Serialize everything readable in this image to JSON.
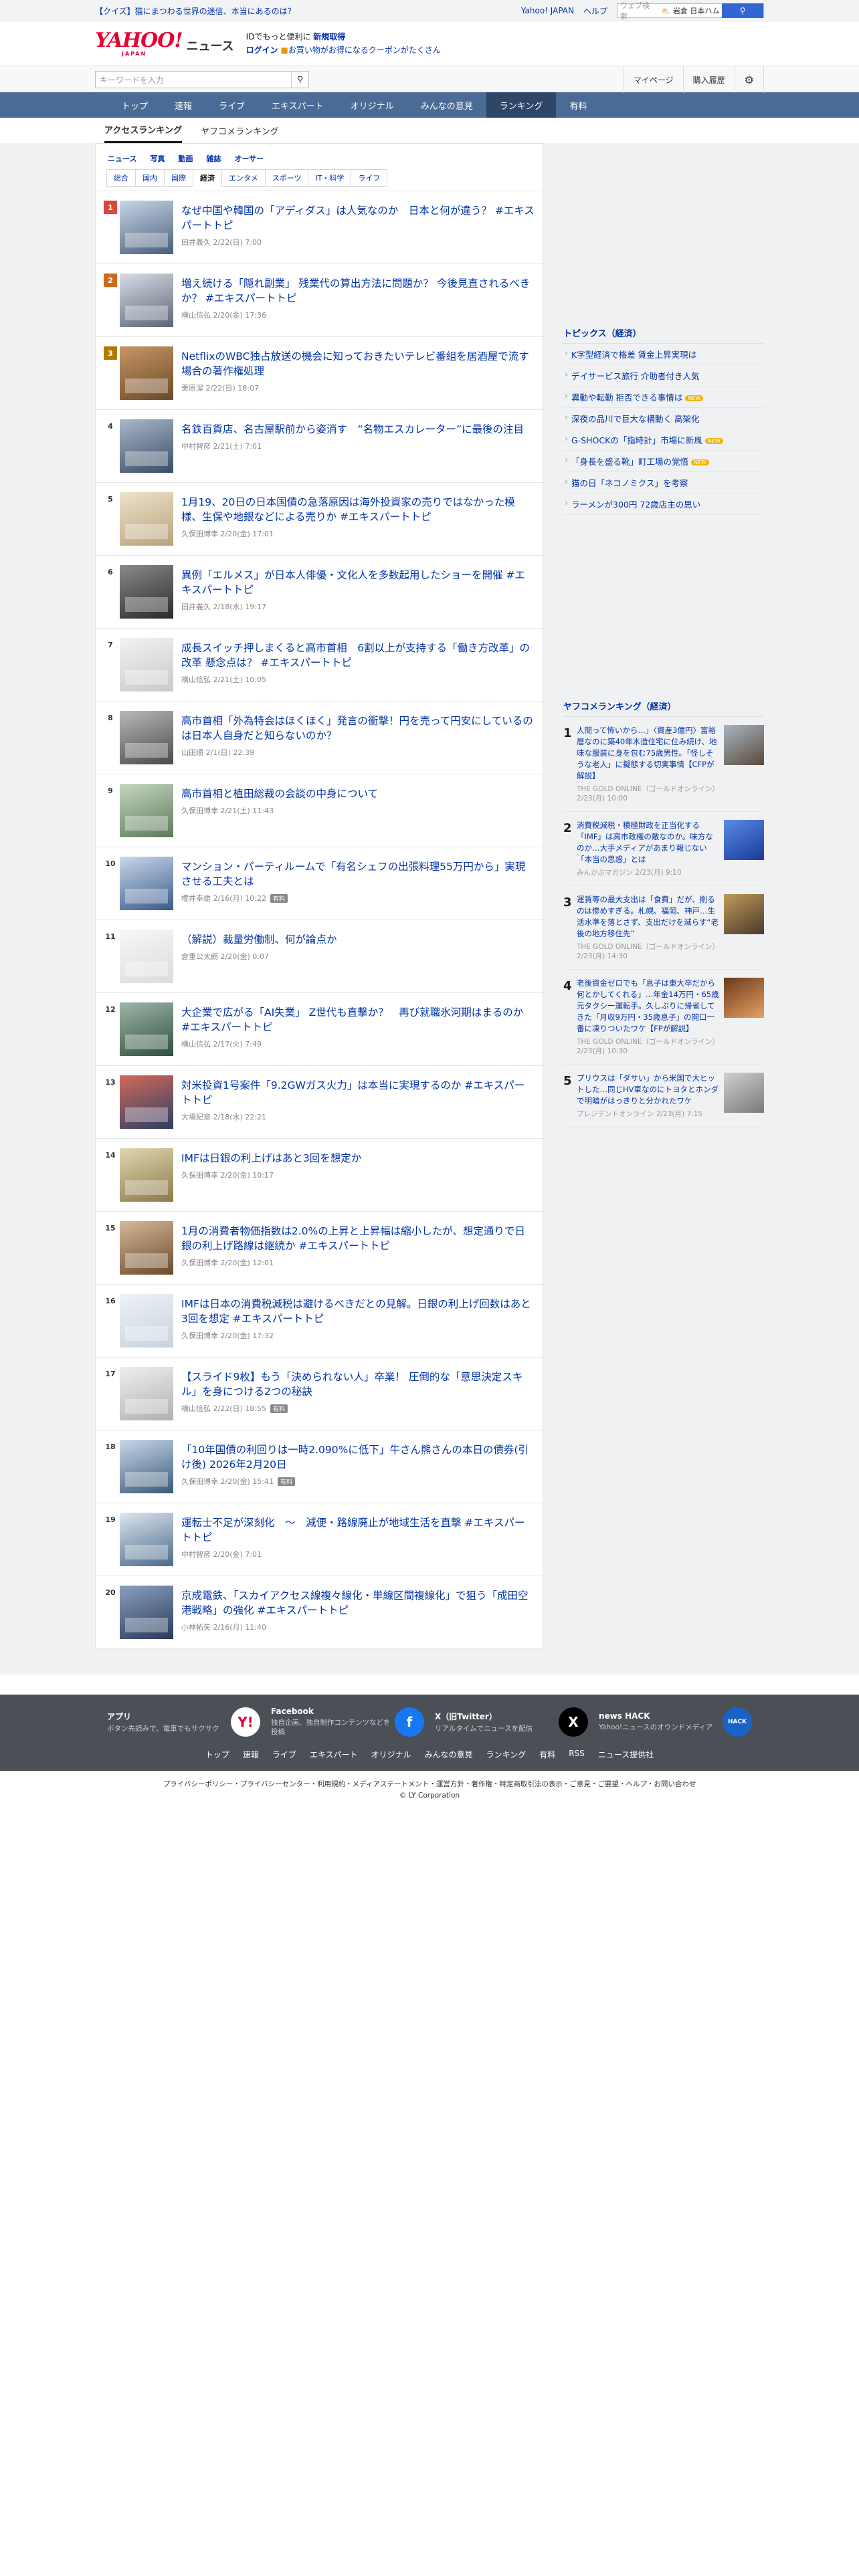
{
  "topbar": {
    "quiz": "【クイズ】猫にまつわる世界の迷信、本当にあるのは？",
    "links": [
      "Yahoo! JAPAN",
      "ヘルプ"
    ],
    "search_placeholder": "ウェブ検索",
    "loc": "⛅ 岩倉 日本ハム",
    "search_icon": "search-icon"
  },
  "header": {
    "logo_yahoo": "YAHOO!",
    "logo_japan": "JAPAN",
    "logo_news": "ニュース",
    "promo1": "IDでもっと便利に",
    "promo1b": "新規取得",
    "promo2a": "ログイン",
    "promo2b": "お買い物がお得になるクーポンがたくさん"
  },
  "search": {
    "placeholder": "キーワードを入力"
  },
  "account": {
    "mypage": "マイページ",
    "history": "購入履歴",
    "gear": "gear-icon"
  },
  "gnav": [
    "トップ",
    "速報",
    "ライブ",
    "エキスパート",
    "オリジナル",
    "みんなの意見",
    "ランキング",
    "有料"
  ],
  "subnav": [
    "アクセスランキング",
    "ヤフコメランキング"
  ],
  "cat1": [
    "ニュース",
    "写真",
    "動画",
    "雑誌",
    "オーサー"
  ],
  "cat2": [
    "総合",
    "国内",
    "国際",
    "経済",
    "エンタメ",
    "スポーツ",
    "IT・科学",
    "ライフ"
  ],
  "ranks": [
    {
      "n": "1",
      "title": "なぜ中国や韓国の「アディダス」は人気なのか　日本と何が違う？ #エキスパートトピ",
      "meta": "田井義久 2/22(日) 7:00",
      "tag": "",
      "c1": "#4a5e7a",
      "c2": "#c8d6e6"
    },
    {
      "n": "2",
      "title": "増え続ける「隠れ副業」 残業代の算出方法に問題か？ 今後見直されるべきか？ #エキスパートトピ",
      "meta": "横山信弘 2/20(金) 17:36",
      "tag": "",
      "c1": "#5b6577",
      "c2": "#d7dde6"
    },
    {
      "n": "3",
      "title": "NetflixのWBC独占放送の機会に知っておきたいテレビ番組を居酒屋で流す場合の著作権処理",
      "meta": "栗原潔 2/22(日) 18:07",
      "tag": "",
      "c1": "#6b4a2a",
      "c2": "#c79664"
    },
    {
      "n": "4",
      "title": "名鉄百貨店、名古屋駅前から姿消す　“名物エスカレーター”に最後の注目",
      "meta": "中村智彦 2/21(土) 7:01",
      "tag": "",
      "c1": "#3a4c66",
      "c2": "#a8b8c8"
    },
    {
      "n": "5",
      "title": "1月19、20日の日本国債の急落原因は海外投資家の売りではなかった模様、生保や地銀などによる売りか #エキスパートトピ",
      "meta": "久保田博幸 2/20(金) 17:01",
      "tag": "",
      "c1": "#b9a27a",
      "c2": "#ede2cc"
    },
    {
      "n": "6",
      "title": "異例「エルメス」が日本人俳優・文化人を多数起用したショーを開催 #エキスパートトピ",
      "meta": "田井義久 2/18(水) 19:17",
      "tag": "",
      "c1": "#2a2a2a",
      "c2": "#8a8a8a"
    },
    {
      "n": "7",
      "title": "成長スイッチ押しまくると高市首相　6割以上が支持する「働き方改革」の改革 懸念点は？ #エキスパートトピ",
      "meta": "横山信弘 2/21(土) 10:05",
      "tag": "",
      "c1": "#c9c9c9",
      "c2": "#f2f2f2"
    },
    {
      "n": "8",
      "title": "高市首相「外為特会はほくほく」発言の衝撃！円を売って円安にしているのは日本人自身だと知らないのか？",
      "meta": "山田順 2/1(日) 22:39",
      "tag": "",
      "c1": "#4a4a4a",
      "c2": "#b8b8b8"
    },
    {
      "n": "9",
      "title": "高市首相と植田総裁の会談の中身について",
      "meta": "久保田博幸 2/21(土) 11:43",
      "tag": "",
      "c1": "#5d7a5a",
      "c2": "#c6d6c2"
    },
    {
      "n": "10",
      "title": "マンション・パーティルームで「有名シェフの出張料理55万円から」実現させる工夫とは",
      "meta": "櫻井幸雄 2/16(月) 10:22",
      "tag": "有料",
      "c1": "#3a5a8a",
      "c2": "#c9d8ea"
    },
    {
      "n": "11",
      "title": "（解説）裁量労働制、何が論点か",
      "meta": "倉重公太朗 2/20(金) 0:07",
      "tag": "",
      "c1": "#dcdcdc",
      "c2": "#f7f7f7"
    },
    {
      "n": "12",
      "title": "大企業で広がる「AI失業」 Z世代も直撃か？　再び就職氷河期はまるのか #エキスパートトピ",
      "meta": "横山信弘 2/17(火) 7:49",
      "tag": "",
      "c1": "#2f4f3f",
      "c2": "#9fb6a8"
    },
    {
      "n": "13",
      "title": "対米投資1号案件「9.2GWガス火力」は本当に実現するのか #エキスパートトピ",
      "meta": "大場紀章 2/18(水) 22:21",
      "tag": "",
      "c1": "#2c3e66",
      "c2": "#d26a5a"
    },
    {
      "n": "14",
      "title": "IMFは日銀の利上げはあと3回を想定か",
      "meta": "久保田博幸 2/20(金) 10:17",
      "tag": "",
      "c1": "#8a7a4a",
      "c2": "#e0d6b0"
    },
    {
      "n": "15",
      "title": "1月の消費者物価指数は2.0%の上昇と上昇幅は縮小したが、想定通りで日銀の利上げ路線は継続か #エキスパートトピ",
      "meta": "久保田博幸 2/20(金) 12:01",
      "tag": "",
      "c1": "#6a4a2a",
      "c2": "#d6b89a"
    },
    {
      "n": "16",
      "title": "IMFは日本の消費税減税は避けるべきだとの見解。日銀の利上げ回数はあと3回を想定 #エキスパートトピ",
      "meta": "久保田博幸 2/20(金) 17:32",
      "tag": "",
      "c1": "#c6d2de",
      "c2": "#eef2f6"
    },
    {
      "n": "17",
      "title": "【スライド9枚】もう「決められない人」卒業！ 圧倒的な「意思決定スキル」を身につける2つの秘訣",
      "meta": "横山信弘 2/22(日) 18:55",
      "tag": "有料",
      "c1": "#b0b0b0",
      "c2": "#efefef"
    },
    {
      "n": "18",
      "title": "「10年国債の利回りは一時2.090%に低下」牛さん熊さんの本日の債券(引け後) 2026年2月20日",
      "meta": "久保田博幸 2/20(金) 15:41",
      "tag": "有料",
      "c1": "#3a5a7a",
      "c2": "#c8d8e8"
    },
    {
      "n": "19",
      "title": "運転士不足が深刻化　〜　減便・路線廃止が地域生活を直撃 #エキスパートトピ",
      "meta": "中村智彦 2/20(金) 7:01",
      "tag": "",
      "c1": "#4a6a8a",
      "c2": "#dde6ef"
    },
    {
      "n": "20",
      "title": "京成電鉄、「スカイアクセス線複々線化・単線区間複線化」で狙う「成田空港戦略」の強化 #エキスパートトピ",
      "meta": "小林拓矢 2/16(月) 11:40",
      "tag": "",
      "c1": "#2a3a5a",
      "c2": "#8aa0c0"
    }
  ],
  "topics": {
    "title": "トピックス（経済）",
    "items": [
      {
        "t": "K字型経済で格差 賃金上昇実現は",
        "new": ""
      },
      {
        "t": "デイサービス旅行 介助者付き人気",
        "new": ""
      },
      {
        "t": "異動や転勤 拒否できる事情は",
        "new": "NEW"
      },
      {
        "t": "深夜の品川で巨大な構動く 高架化",
        "new": ""
      },
      {
        "t": "G-SHOCKの「指時計」市場に新風",
        "new": "NEW"
      },
      {
        "t": "「身長を盛る靴」町工場の覚悟",
        "new": "NEW"
      },
      {
        "t": "猫の日「ネコノミクス」を考察",
        "new": ""
      },
      {
        "t": "ラーメンが300円 72歳店主の思い",
        "new": ""
      }
    ]
  },
  "yrank": {
    "title": "ヤフコメランキング（経済）",
    "items": [
      {
        "n": "1",
        "t": "人間って怖いから…」〈資産3億円〉富裕層なのに築40年木造住宅に住み続け、地味な服装に身を包む75歳男性。「怪しそうな老人」に擬態する切実事情【CFPが解説】",
        "m": "THE GOLD ONLINE（ゴールドオンライン） 2/23(月) 10:00",
        "c1": "#5a4a3a",
        "c2": "#a8b6c4"
      },
      {
        "n": "2",
        "t": "消費税減税・積極財政を正当化する「IMF」は高市政権の敵なのか。味方なのか…大手メディアがあまり報じない「本当の思惑」とは",
        "m": "みんかぶマガジン 2/23(月) 9:10",
        "c1": "#1a3a9a",
        "c2": "#5a8ae6"
      },
      {
        "n": "3",
        "t": "運賃等の最大支出は「食費」だが、削るのは惨めすぎる。札幌、福岡、神戸…生活水準を落とさず、支出だけを減らす“老後の地方移住先”",
        "m": "THE GOLD ONLINE（ゴールドオンライン） 2/23(月) 14:30",
        "c1": "#4a3a2a",
        "c2": "#c09a5a"
      },
      {
        "n": "4",
        "t": "老後資金ゼロでも「息子は東大卒だから何とかしてくれる」…年金14万円・65歳元タクシー運転手。久しぶりに帰省してきた「月収9万円・35歳息子」の開口一番に凍りついたワケ【FPが解説】",
        "m": "THE GOLD ONLINE（ゴールドオンライン） 2/23(月) 10:30",
        "c1": "#e6a064",
        "c2": "#6a3a1a"
      },
      {
        "n": "5",
        "t": "プリウスは「ダサい」から米国で大ヒットした…同じHV車なのにトヨタとホンダで明暗がはっきりと分かれたワケ",
        "m": "プレジデントオンライン 2/23(月) 7:15",
        "c1": "#7a7a7a",
        "c2": "#d0d0d0"
      }
    ]
  },
  "footer": {
    "apps": [
      {
        "h": "アプリ",
        "d": "ボタン先読みで、電車でもサクサク",
        "ic": "Y!",
        "icon": "app-icon",
        "bg": "#ffffff",
        "fg": "#e60033"
      },
      {
        "h": "Facebook",
        "d": "独自企画、独自制作コンテンツなどを投稿",
        "ic": "f",
        "icon": "facebook-icon",
        "bg": "#1877f2",
        "fg": "#ffffff"
      },
      {
        "h": "X（旧Twitter）",
        "d": "リアルタイムでニュースを配信",
        "ic": "X",
        "icon": "x-icon",
        "bg": "#000000",
        "fg": "#ffffff"
      },
      {
        "h": "news HACK",
        "d": "Yahoo!ニュースのオウンドメディア",
        "ic": "HACK",
        "icon": "newshack-icon",
        "bg": "#1a63c6",
        "fg": "#ffffff"
      }
    ],
    "links": [
      "トップ",
      "速報",
      "ライブ",
      "エキスパート",
      "オリジナル",
      "みんなの意見",
      "ランキング",
      "有料",
      "RSS",
      "ニュース提供社"
    ],
    "legal": "プライバシーポリシー・プライバシーセンター・利用規約・メディアステートメント・運営方針・著作権・特定商取引法の表示・ご意見・ご要望・ヘルプ・お問い合わせ",
    "copy": "© LY Corporation"
  }
}
